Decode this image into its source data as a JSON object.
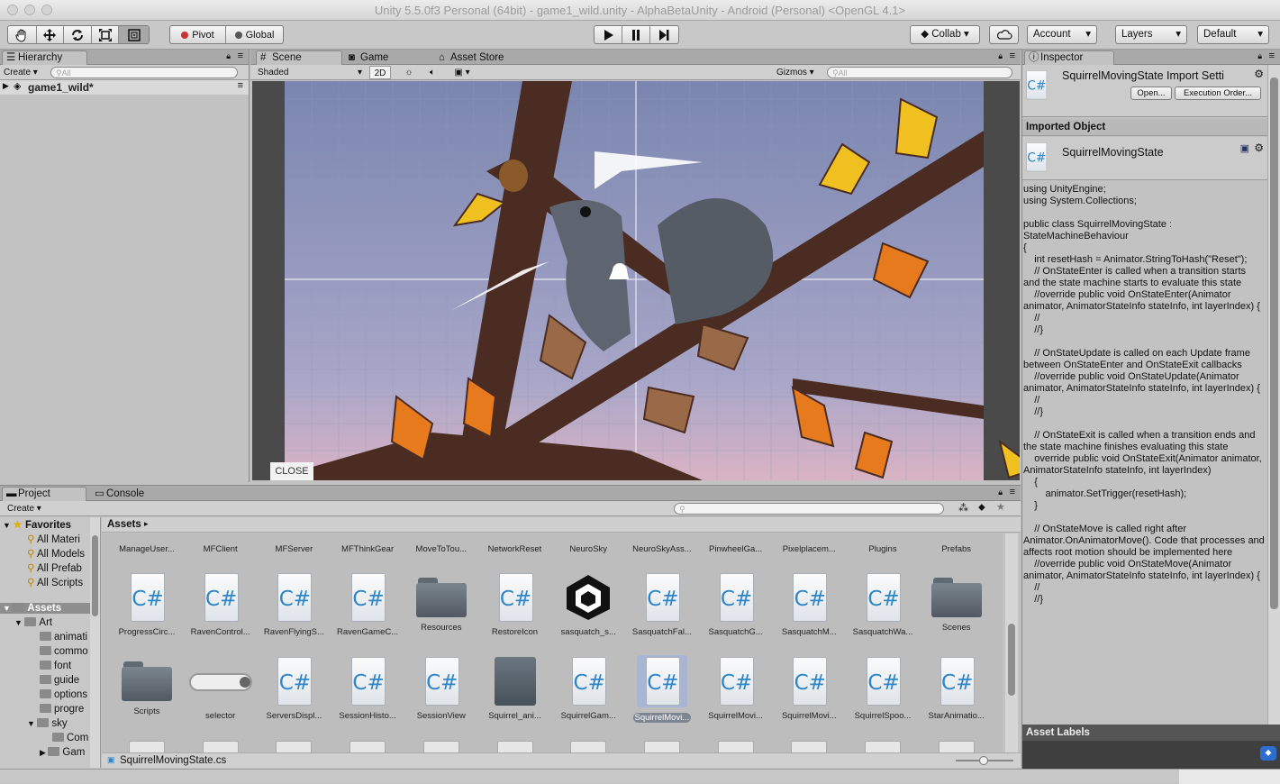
{
  "window": {
    "title": "Unity 5.5.0f3 Personal (64bit) - game1_wild.unity - AlphaBetaUnity - Android (Personal) <OpenGL 4.1>"
  },
  "toolbar": {
    "pivot": "Pivot",
    "global": "Global",
    "collab": "Collab",
    "account": "Account",
    "layers": "Layers",
    "layout": "Default"
  },
  "hierarchy": {
    "tab": "Hierarchy",
    "create": "Create",
    "search_placeholder": "All",
    "scene": "game1_wild*"
  },
  "scene": {
    "tab_scene": "Scene",
    "tab_game": "Game",
    "tab_store": "Asset Store",
    "shading": "Shaded",
    "mode2d": "2D",
    "gizmos": "Gizmos",
    "search_placeholder": "All",
    "close": "CLOSE"
  },
  "inspector": {
    "tab": "Inspector",
    "header_title": "SquirrelMovingState Import Setti",
    "open": "Open...",
    "exec_order": "Execution Order...",
    "imported_object": "Imported Object",
    "object_name": "SquirrelMovingState",
    "asset_labels": "Asset Labels",
    "code": "using UnityEngine;\nusing System.Collections;\n\npublic class SquirrelMovingState : StateMachineBehaviour\n{\n    int resetHash = Animator.StringToHash(\"Reset\");\n    // OnStateEnter is called when a transition starts and the state machine starts to evaluate this state\n    //override public void OnStateEnter(Animator animator, AnimatorStateInfo stateInfo, int layerIndex) {\n    //\n    //}\n\n    // OnStateUpdate is called on each Update frame between OnStateEnter and OnStateExit callbacks\n    //override public void OnStateUpdate(Animator animator, AnimatorStateInfo stateInfo, int layerIndex) {\n    //\n    //}\n\n    // OnStateExit is called when a transition ends and the state machine finishes evaluating this state\n    override public void OnStateExit(Animator animator, AnimatorStateInfo stateInfo, int layerIndex)\n    {\n        animator.SetTrigger(resetHash);\n    }\n\n    // OnStateMove is called right after Animator.OnAnimatorMove(). Code that processes and affects root motion should be implemented here\n    //override public void OnStateMove(Animator animator, AnimatorStateInfo stateInfo, int layerIndex) {\n    //\n    //}"
  },
  "project": {
    "tab_project": "Project",
    "tab_console": "Console",
    "create": "Create",
    "breadcrumb": "Assets",
    "footer_file": "SquirrelMovingState.cs",
    "favorites_label": "Favorites",
    "favorites": [
      "All Materi",
      "All Models",
      "All Prefab",
      "All Scripts"
    ],
    "assets_label": "Assets",
    "tree": [
      "Art",
      "animati",
      "commo",
      "font",
      "guide",
      "options",
      "progre",
      "sky",
      "Com",
      "Gam"
    ],
    "row1": [
      "ManageUser...",
      "MFClient",
      "MFServer",
      "MFThinkGear",
      "MoveToTou...",
      "NetworkReset",
      "NeuroSky",
      "NeuroSkyAss...",
      "PinwheelGa...",
      "Pixelplacem...",
      "Plugins",
      "Prefabs"
    ],
    "row2": [
      "ProgressCirc...",
      "RavenControl...",
      "RavenFlyingS...",
      "RavenGameC...",
      "Resources",
      "RestoreIcon",
      "sasquatch_s...",
      "SasquatchFal...",
      "SasquatchG...",
      "SasquatchM...",
      "SasquatchWa...",
      "Scenes"
    ],
    "row3": [
      "Scripts",
      "selector",
      "ServersDispl...",
      "SessionHisto...",
      "SessionView",
      "Squirrel_ani...",
      "SquirrelGam...",
      "SquirrelMovi...",
      "SquirrelMovi...",
      "SquirrelMovi...",
      "SquirrelSpoo...",
      "StarAnimatio..."
    ],
    "row2_types": [
      "cs",
      "cs",
      "cs",
      "cs",
      "folder",
      "cs",
      "unity",
      "cs",
      "cs",
      "cs",
      "cs",
      "folder"
    ],
    "row3_types": [
      "folder",
      "selector",
      "cs",
      "cs",
      "cs",
      "anim",
      "cs",
      "cs",
      "cs",
      "cs",
      "cs",
      "cs"
    ],
    "selected_index": 7,
    "cs_glyph": "C#"
  }
}
